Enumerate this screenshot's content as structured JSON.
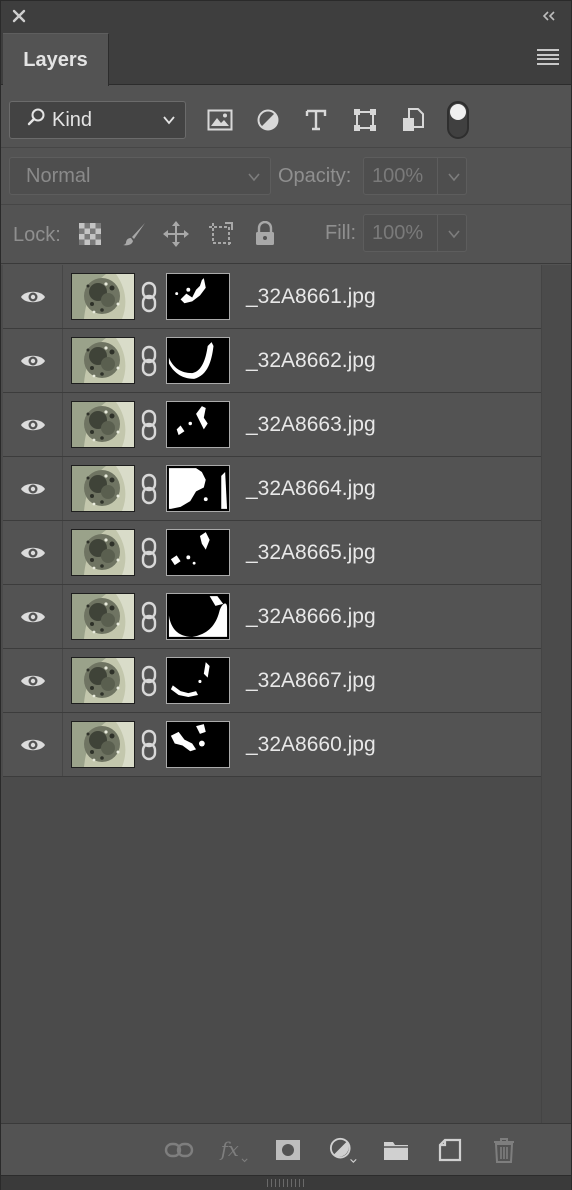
{
  "window": {
    "close_icon": "close-icon",
    "collapse_icon": "double-chevron-left-icon"
  },
  "panel": {
    "tab_label": "Layers",
    "menu_icon": "panel-menu-icon"
  },
  "filter": {
    "kind_label": "Kind",
    "filter_icons": [
      "image-filter-icon",
      "adjustment-filter-icon",
      "type-filter-icon",
      "shape-filter-icon",
      "smart-object-filter-icon"
    ],
    "toggle_on": true
  },
  "blend": {
    "mode": "Normal",
    "opacity_label": "Opacity:",
    "opacity_value": "100%"
  },
  "lock": {
    "label": "Lock:",
    "icons": [
      "lock-transparent-pixels-icon",
      "lock-image-pixels-icon",
      "lock-position-icon",
      "lock-artboard-icon",
      "lock-all-icon"
    ],
    "fill_label": "Fill:",
    "fill_value": "100%"
  },
  "layers": [
    {
      "name": "_32A8661.jpg",
      "visible": true,
      "mask": "m1"
    },
    {
      "name": "_32A8662.jpg",
      "visible": true,
      "mask": "m2"
    },
    {
      "name": "_32A8663.jpg",
      "visible": true,
      "mask": "m3"
    },
    {
      "name": "_32A8664.jpg",
      "visible": true,
      "mask": "m4"
    },
    {
      "name": "_32A8665.jpg",
      "visible": true,
      "mask": "m5"
    },
    {
      "name": "_32A8666.jpg",
      "visible": true,
      "mask": "m6"
    },
    {
      "name": "_32A8667.jpg",
      "visible": true,
      "mask": "m7"
    },
    {
      "name": "_32A8660.jpg",
      "visible": true,
      "mask": "m8"
    }
  ],
  "bottom_bar": {
    "icons": [
      "link-layers-icon",
      "fx-icon",
      "add-mask-icon",
      "adjustment-layer-icon",
      "new-group-icon",
      "new-layer-icon",
      "delete-layer-icon"
    ]
  },
  "colors": {
    "panel_bg": "#535353",
    "titlebar_bg": "#3e3e3e",
    "text": "#e4e4e4",
    "dim_text": "#8f8f8f"
  }
}
